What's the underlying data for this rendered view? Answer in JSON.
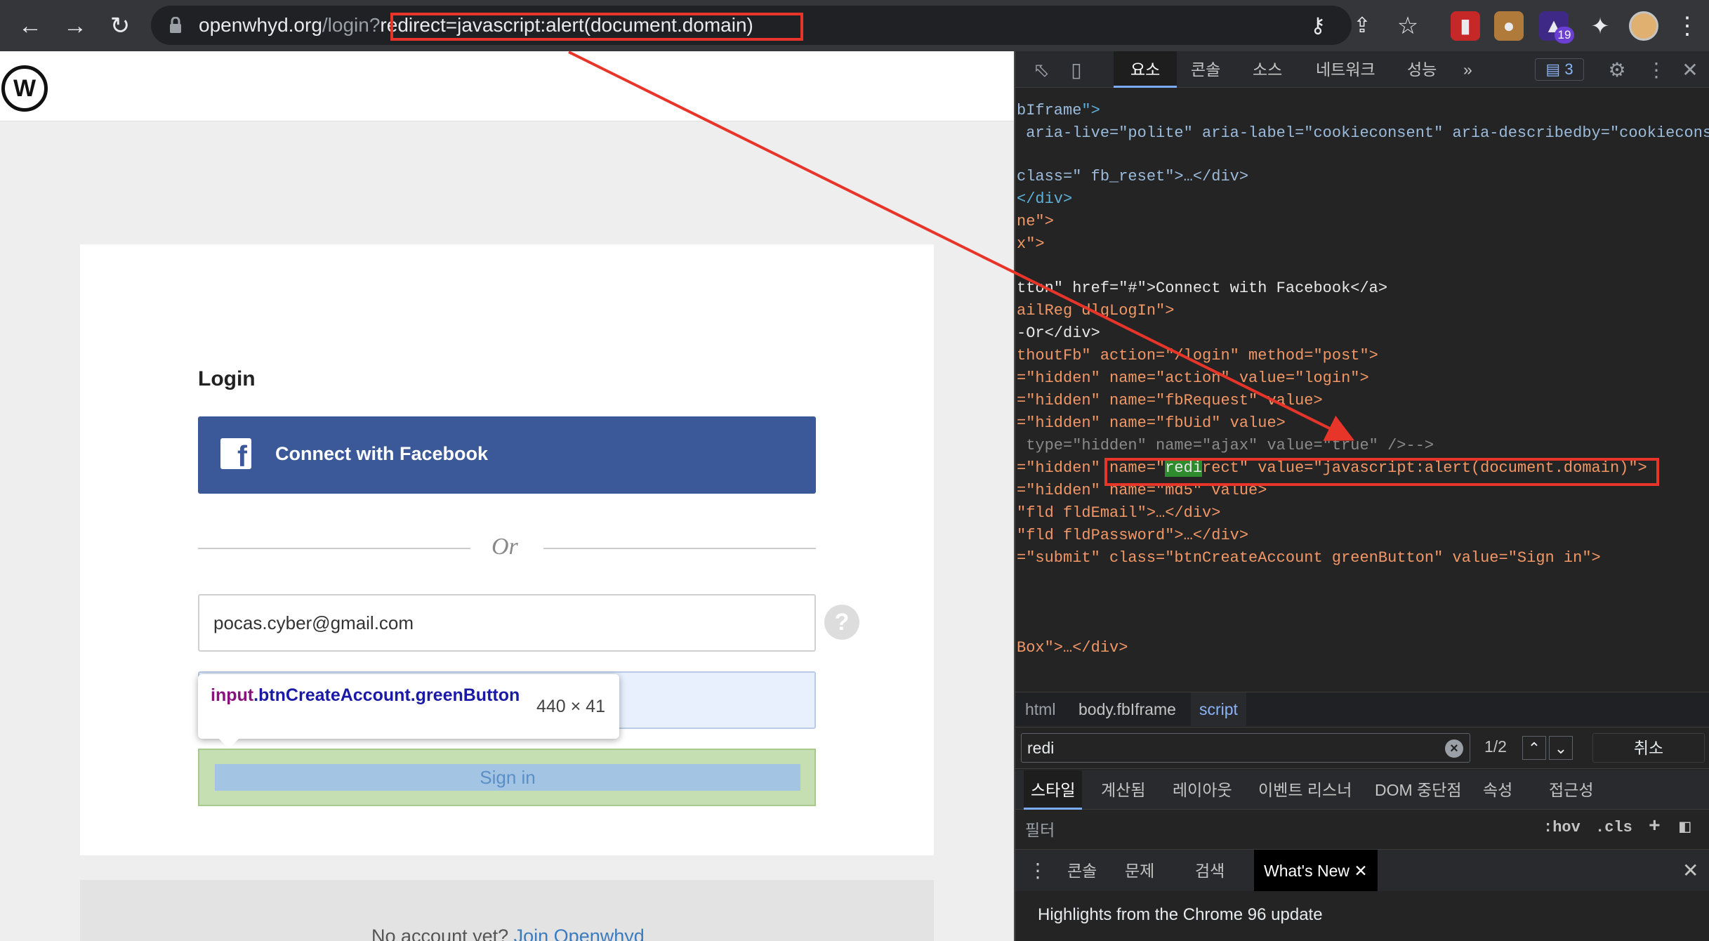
{
  "browser": {
    "url_host": "openwhyd.org",
    "url_path": "/login?",
    "url_query": "redirect=javascript:alert(document.domain)",
    "extension_badge": "19"
  },
  "site": {
    "logo_letter": "W",
    "login_title": "Login",
    "facebook_button": "Connect with Facebook",
    "or_label": "Or",
    "email_value": "pocas.cyber@gmail.com",
    "help_label": "?",
    "signin_label": "Sign in",
    "tooltip": {
      "tag": "input",
      "classes": ".btnCreateAccount.greenButton",
      "size": "440 × 41"
    },
    "signup_prompt": "No account yet?",
    "signup_link": "Join Openwhyd"
  },
  "devtools": {
    "tabs": [
      "요소",
      "콘솔",
      "소스",
      "네트워크",
      "성능"
    ],
    "more_tabs": "»",
    "issues_count": "3",
    "dom_lines": [
      {
        "a": "bIframe",
        "b": "\">"
      },
      {
        "text": " aria-live=\"polite\" aria-label=\"cookieconsent\" aria-describedby=\"cookiecons"
      },
      {
        "text": "class=\" fb_reset\">…</div>"
      },
      {
        "text": "</div>"
      },
      {
        "text": "ne\">"
      },
      {
        "text": "x\">"
      },
      {
        "text": "tton\" href=\"#\">Connect with Facebook</a>"
      },
      {
        "text": "ailReg dlgLogIn\">"
      },
      {
        "text": "-Or</div>"
      },
      {
        "text": "thoutFb\" action=\"/login\" method=\"post\">"
      },
      {
        "text": "=\"hidden\" name=\"action\" value=\"login\">"
      },
      {
        "text": "=\"hidden\" name=\"fbRequest\" value>"
      },
      {
        "text": "=\"hidden\" name=\"fbUid\" value>"
      },
      {
        "text": " type=\"hidden\" name=\"ajax\" value=\"true\" />-->"
      },
      {
        "text": "=\"hidden\" name=\"redirect\" value=\"javascript:alert(document.domain)\">"
      },
      {
        "text": "=\"hidden\" name=\"md5\" value>"
      },
      {
        "text": "\"fld fldEmail\">…</div>"
      },
      {
        "text": "\"fld fldPassword\">…</div>"
      },
      {
        "text": "=\"submit\" class=\"btnCreateAccount greenButton\" value=\"Sign in\">"
      },
      {
        "text": "Box\">…</div>"
      }
    ],
    "breadcrumb": [
      "html",
      "body.fbIframe",
      "script"
    ],
    "search": {
      "query": "redi",
      "count": "1/2",
      "cancel": "취소"
    },
    "style_tabs": [
      "스타일",
      "계산됨",
      "레이아웃",
      "이벤트 리스너",
      "DOM 중단점",
      "속성",
      "접근성"
    ],
    "filter_placeholder": "필터",
    "filter_tools": [
      ":hov",
      ".cls",
      "+"
    ],
    "drawer_tabs": [
      "콘솔",
      "문제",
      "검색",
      "What's New"
    ],
    "whats_new_text": "Highlights from the Chrome 96 update"
  },
  "colors": {
    "annotation": "#e8352a",
    "facebook": "#3b5998",
    "devtools_bg": "#242424"
  }
}
